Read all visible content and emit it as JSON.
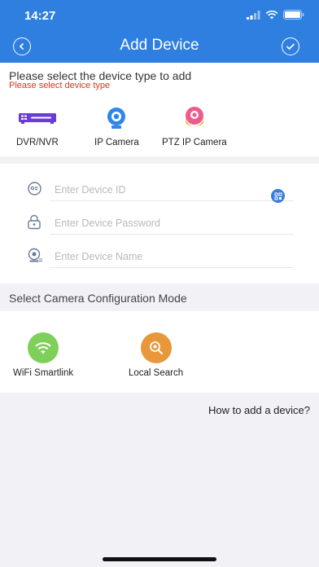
{
  "status_bar": {
    "time": "14:27"
  },
  "nav": {
    "title": "Add Device"
  },
  "device_type": {
    "prompt": "Please select the device type to add",
    "error": "Please select device type",
    "items": [
      {
        "label": "DVR/NVR",
        "icon": "dvr-icon"
      },
      {
        "label": "IP Camera",
        "icon": "ip-camera-icon"
      },
      {
        "label": "PTZ IP Camera",
        "icon": "ptz-camera-icon"
      }
    ]
  },
  "form": {
    "device_id_placeholder": "Enter Device ID",
    "device_password_placeholder": "Enter Device Password",
    "device_name_placeholder": "Enter Device Name"
  },
  "config_mode": {
    "header": "Select Camera Configuration Mode",
    "items": [
      {
        "label": "WiFi Smartlink",
        "icon": "wifi-icon",
        "color": "#7fcf5a"
      },
      {
        "label": "Local Search",
        "icon": "search-icon",
        "color": "#e8973a"
      }
    ]
  },
  "help": {
    "link": "How to add a device?"
  },
  "colors": {
    "accent": "#2e7fe0",
    "error": "#e0331f"
  }
}
